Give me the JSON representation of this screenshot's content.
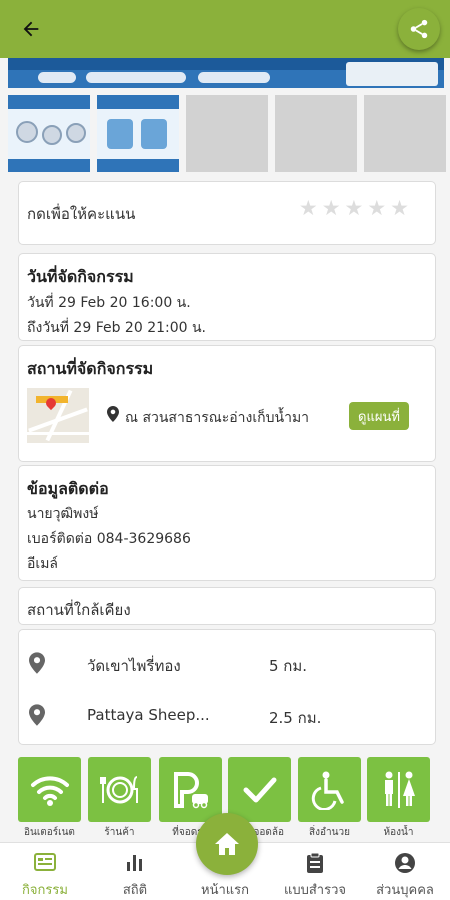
{
  "header": {
    "back_icon": "arrow-left-icon",
    "share_icon": "share-icon"
  },
  "rating": {
    "label": "กดเพื่อให้คะแนน",
    "stars": 5,
    "value": 0
  },
  "event_date": {
    "title": "วันที่จัดกิจกรรม",
    "start": "วันที่ 29 Feb 20 16:00 น.",
    "end": "ถึงวันที่ 29 Feb 20 21:00 น."
  },
  "venue": {
    "title": "สถานที่จัดกิจกรรม",
    "location": "ณ สวนสาธารณะอ่างเก็บน้ำมา",
    "map_button": "ดูแผนที่"
  },
  "contact": {
    "title": "ข้อมูลติดต่อ",
    "name": "นายวุฒิพงษ์",
    "phone": "เบอร์ติดต่อ 084-3629686",
    "email": "อีเมล์"
  },
  "nearby": {
    "title": "สถานที่ใกล้เคียง",
    "items": [
      {
        "name": "วัดเขาไพรี่ทอง",
        "distance": "5 กม."
      },
      {
        "name": "Pattaya Sheep...",
        "distance": "2.5 กม."
      }
    ]
  },
  "facilities": [
    {
      "icon": "wifi-icon",
      "label": "อินเตอร์เนต"
    },
    {
      "icon": "restaurant-icon",
      "label": "ร้านค้า"
    },
    {
      "icon": "parking-icon",
      "label": "ที่จอดรถ"
    },
    {
      "icon": "check-icon",
      "label": "ลานจอดล้อ"
    },
    {
      "icon": "wheelchair-icon",
      "label": "สิ่งอำนวย"
    },
    {
      "icon": "restroom-icon",
      "label": "ห้องน้ำ"
    }
  ],
  "bottom_nav": [
    {
      "icon": "activities-icon",
      "label": "กิจกรรม",
      "active": true
    },
    {
      "icon": "stats-icon",
      "label": "สถิติ"
    },
    {
      "icon": "home-icon",
      "label": "หน้าแรก"
    },
    {
      "icon": "survey-icon",
      "label": "แบบสำรวจ"
    },
    {
      "icon": "profile-icon",
      "label": "ส่วนบุคคล"
    }
  ],
  "colors": {
    "primary": "#8bb13b",
    "facility": "#7cc142"
  }
}
